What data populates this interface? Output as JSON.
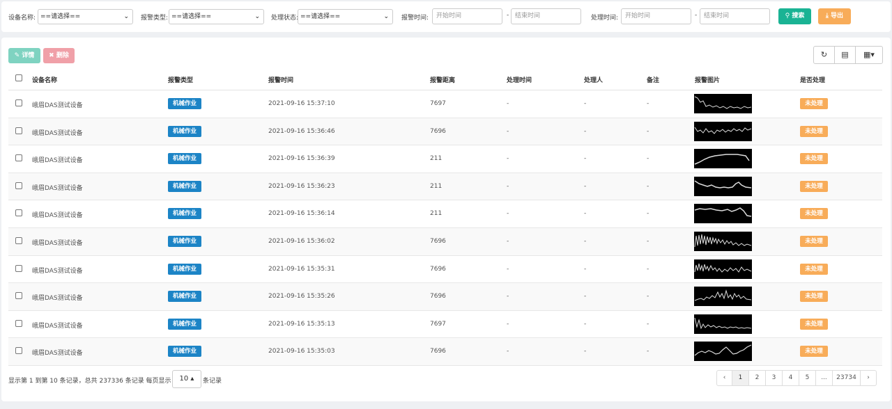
{
  "filters": {
    "device_label": "设备名称:",
    "device_value": "==请选择==",
    "alarm_type_label": "报警类型:",
    "alarm_type_value": "==请选择==",
    "status_label": "处理状态:",
    "status_value": "==请选择==",
    "alarm_time_label": "报警时间:",
    "handle_time_label": "处理时间:",
    "start_placeholder": "开始时间",
    "end_placeholder": "结束时间",
    "dash": "-",
    "search_label": "搜索",
    "export_label": "导出"
  },
  "toolbar": {
    "detail_label": "详情",
    "delete_label": "删除"
  },
  "columns": [
    "设备名称",
    "报警类型",
    "报警时间",
    "报警距离",
    "处理时间",
    "处理人",
    "备注",
    "报警图片",
    "是否处理"
  ],
  "rows": [
    {
      "device": "峨眉DAS测试设备",
      "type": "机械作业",
      "time": "2021-09-16 15:37:10",
      "distance": "7697",
      "handle_time": "-",
      "handler": "-",
      "note": "-",
      "status": "未处理",
      "wave": "a"
    },
    {
      "device": "峨眉DAS测试设备",
      "type": "机械作业",
      "time": "2021-09-16 15:36:46",
      "distance": "7696",
      "handle_time": "-",
      "handler": "-",
      "note": "-",
      "status": "未处理",
      "wave": "b"
    },
    {
      "device": "峨眉DAS测试设备",
      "type": "机械作业",
      "time": "2021-09-16 15:36:39",
      "distance": "211",
      "handle_time": "-",
      "handler": "-",
      "note": "-",
      "status": "未处理",
      "wave": "c"
    },
    {
      "device": "峨眉DAS测试设备",
      "type": "机械作业",
      "time": "2021-09-16 15:36:23",
      "distance": "211",
      "handle_time": "-",
      "handler": "-",
      "note": "-",
      "status": "未处理",
      "wave": "d"
    },
    {
      "device": "峨眉DAS测试设备",
      "type": "机械作业",
      "time": "2021-09-16 15:36:14",
      "distance": "211",
      "handle_time": "-",
      "handler": "-",
      "note": "-",
      "status": "未处理",
      "wave": "e"
    },
    {
      "device": "峨眉DAS测试设备",
      "type": "机械作业",
      "time": "2021-09-16 15:36:02",
      "distance": "7696",
      "handle_time": "-",
      "handler": "-",
      "note": "-",
      "status": "未处理",
      "wave": "f"
    },
    {
      "device": "峨眉DAS测试设备",
      "type": "机械作业",
      "time": "2021-09-16 15:35:31",
      "distance": "7696",
      "handle_time": "-",
      "handler": "-",
      "note": "-",
      "status": "未处理",
      "wave": "g"
    },
    {
      "device": "峨眉DAS测试设备",
      "type": "机械作业",
      "time": "2021-09-16 15:35:26",
      "distance": "7696",
      "handle_time": "-",
      "handler": "-",
      "note": "-",
      "status": "未处理",
      "wave": "h"
    },
    {
      "device": "峨眉DAS测试设备",
      "type": "机械作业",
      "time": "2021-09-16 15:35:13",
      "distance": "7697",
      "handle_time": "-",
      "handler": "-",
      "note": "-",
      "status": "未处理",
      "wave": "i"
    },
    {
      "device": "峨眉DAS测试设备",
      "type": "机械作业",
      "time": "2021-09-16 15:35:03",
      "distance": "7696",
      "handle_time": "-",
      "handler": "-",
      "note": "-",
      "status": "未处理",
      "wave": "j"
    }
  ],
  "footer": {
    "summary": "显示第 1 到第 10 条记录，总共 237336 条记录 每页显示",
    "page_size": "10 ▴",
    "suffix": "条记录"
  },
  "pagination": [
    "‹",
    "1",
    "2",
    "3",
    "4",
    "5",
    "...",
    "23734",
    "›"
  ],
  "colors": {
    "search": "#1ab394",
    "export": "#f8ac59",
    "type_tag": "#1c84c6",
    "status_tag": "#f8ac59"
  },
  "icons": {
    "detail": "edit-icon",
    "delete": "close-icon",
    "search": "search-icon",
    "export": "download-icon",
    "refresh": "refresh-icon",
    "toggle": "card-view-icon",
    "columns": "columns-grid-icon"
  }
}
